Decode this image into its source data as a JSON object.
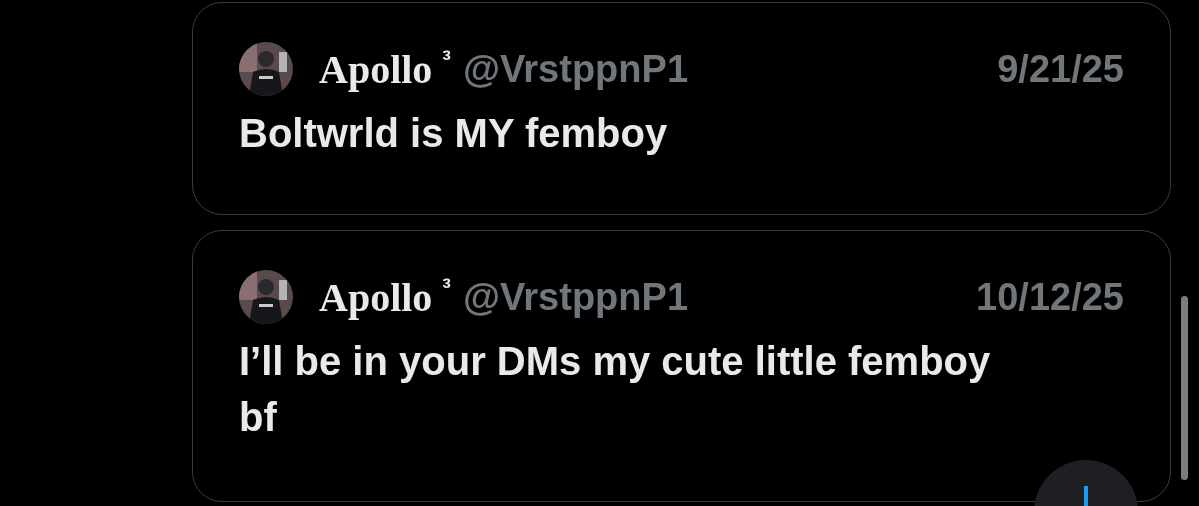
{
  "posts": [
    {
      "name": "Apollo",
      "name_suffix": "³",
      "handle": "@VrstppnP1",
      "date": "9/21/25",
      "text": "Boltwrld is MY femboy"
    },
    {
      "name": "Apollo",
      "name_suffix": "³",
      "handle": "@VrstppnP1",
      "date": "10/12/25",
      "text": "I’ll be in your DMs my cute little femboy bf"
    }
  ]
}
